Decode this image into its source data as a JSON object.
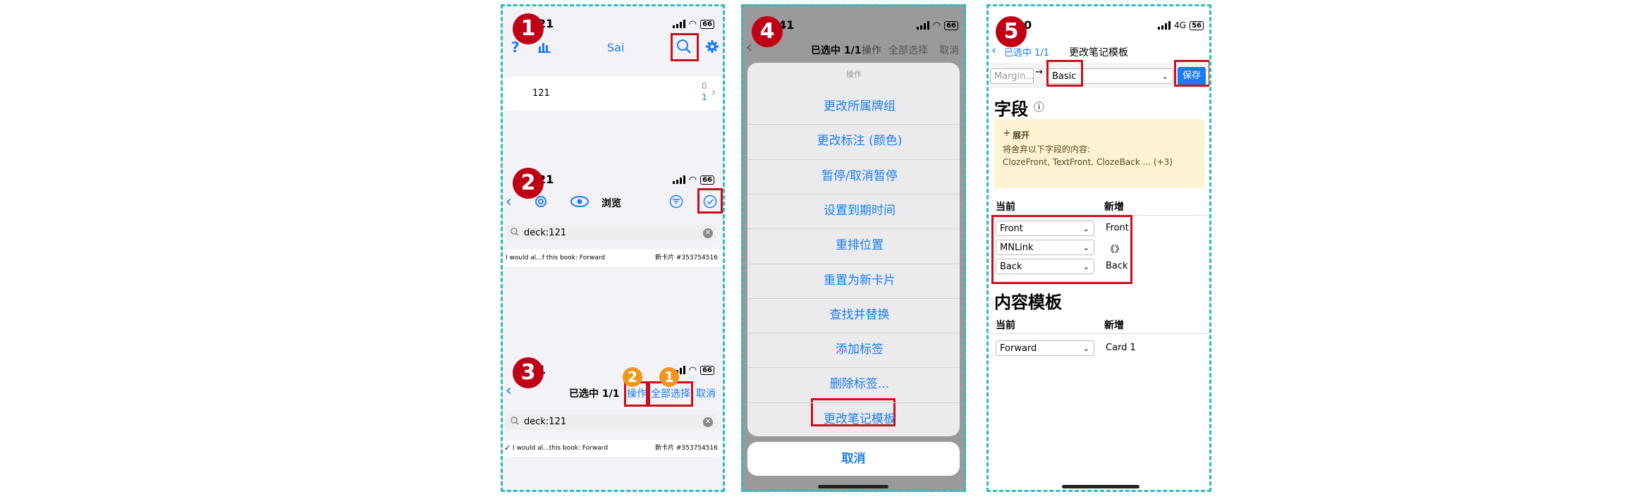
{
  "colors": {
    "accent": "#1a7cf0",
    "highlight": "#c8101e",
    "panel_border": "#2bbdb8",
    "badge_red": "#c00014",
    "badge_orange": "#f0961e",
    "notice_bg": "#fdf3d2"
  },
  "badges": {
    "b1": "1",
    "b2": "2",
    "b3": "3",
    "b4": "4",
    "b5": "5",
    "o1": "1",
    "o2": "2"
  },
  "status": {
    "p1": "21",
    "p2": "21",
    "p3": "1",
    "p4": "41",
    "p5": "0",
    "battery": "66",
    "battery5": "56",
    "net4g": "4G"
  },
  "p1": {
    "help": "?",
    "title": "Sai",
    "deck_name": "121",
    "count_new": "0",
    "count_due": "1",
    "chevron": "›"
  },
  "p2": {
    "title": "浏览",
    "search": "deck:121",
    "row_text": "I would al...f this book: Forward",
    "row_meta": "新卡片 #353754516"
  },
  "p3": {
    "selected": "已选中 1/1",
    "ops": "操作",
    "select_all": "全部选择",
    "cancel": "取消",
    "search": "deck:121",
    "row_text": "I would al...this book: Forward",
    "row_meta": "新卡片 #353754516",
    "check": "✓"
  },
  "p4": {
    "selected": "已选中 1/1",
    "ops": "操作",
    "select_all": "全部选择",
    "cancel": "取消",
    "sheet_title": "操作",
    "actions": [
      "更改所属牌组",
      "更改标注 (颜色)",
      "暂停/取消暂停",
      "设置到期时间",
      "重排位置",
      "重置为新卡片",
      "查找并替换",
      "添加标签",
      "删除标签...",
      "更改笔记模板"
    ],
    "cancel_btn": "取消"
  },
  "p5": {
    "back": "已选中 1/1",
    "title": "更改笔记模板",
    "from_placeholder": "Margin...",
    "arrow": "→",
    "to_value": "Basic",
    "save": "保存",
    "fields_title": "字段",
    "info": "ⓘ",
    "expand": "展开",
    "plus": "+",
    "warning": "将舍弃以下字段的内容:",
    "dropped": "ClozeFront, TextFront, ClozeBack ... (+3)",
    "col_current": "当前",
    "col_new": "新增",
    "field_rows": [
      {
        "cur": "Front",
        "new": "Front"
      },
      {
        "cur": "MNLink",
        "new": "《》"
      },
      {
        "cur": "Back",
        "new": "Back"
      }
    ],
    "templates_title": "内容模板",
    "template_rows": [
      {
        "cur": "Forward",
        "new": "Card 1"
      }
    ]
  }
}
